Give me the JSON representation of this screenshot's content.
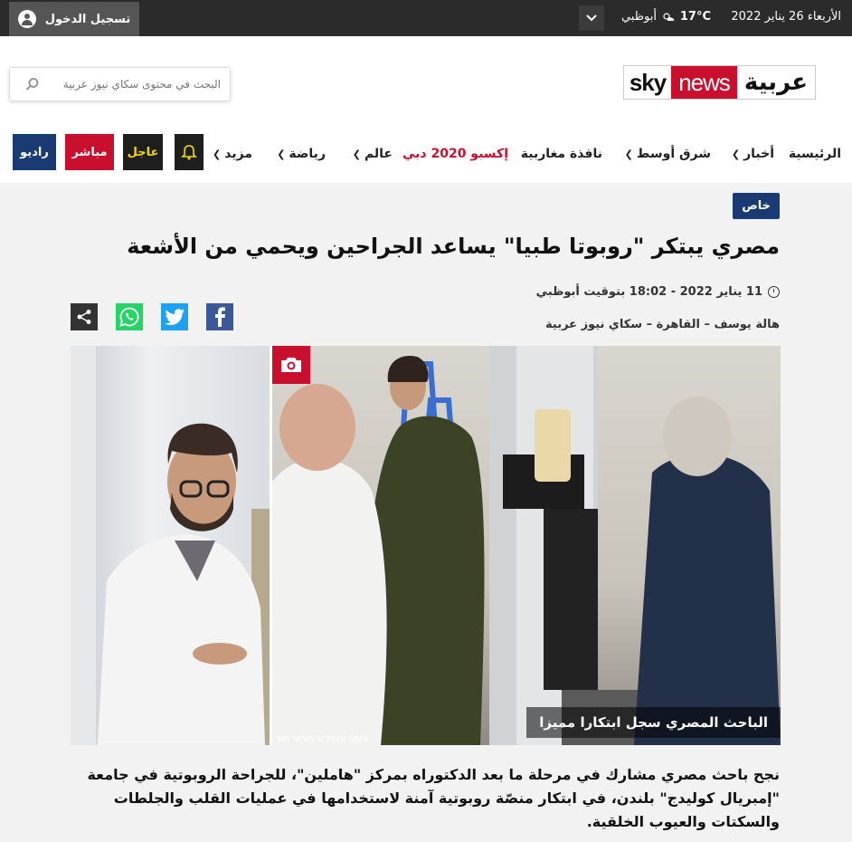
{
  "topbar": {
    "login_label": "تسجيل الدخول",
    "date": "الأربعاء 26 يناير 2022",
    "temperature": "17°C",
    "city": "أبوظبي"
  },
  "header": {
    "search_placeholder": "البحث في محتوى سكاي نيوز عربية",
    "logo": {
      "sky": "sky",
      "news": "news",
      "arabia": "عربية"
    }
  },
  "nav": {
    "items": [
      "الرئيسية",
      "أخبار",
      "شرق أوسط",
      "نافذة مغاربية",
      "إكسبو 2020 دبي",
      "عالم",
      "رياضة",
      "مزيد"
    ],
    "urgent": "عاجل",
    "live": "مباشر",
    "radio": "راديو"
  },
  "article": {
    "tag": "خاص",
    "title": "مصري يبتكر \"روبوتا طبيا\" يساعد الجراحين ويحمي من الأشعة",
    "date": "11 يناير 2022 - 18:02 بتوقيت أبوظبي",
    "byline": "هالة يوسف – القاهرة – سكاي نيوز عربية",
    "image_caption": "الباحث المصري سجل ابتكارا مميزا",
    "image_credit": "SKY NEWS SCREEN GRAB",
    "body": "نجح باحث مصري مشارك في مرحلة ما بعد الدكتوراه بمركز \"هاملين\"، للجراحة الروبوتية في جامعة \"إمبريال كوليدج\" بلندن، في ابتكار منصّة روبوتية آمنة لاستخدامها في عمليات القلب والجلطات والسكتات والعيوب الخلقية."
  },
  "colors": {
    "brand_red": "#c8102e",
    "navy": "#1a3a73",
    "urgent_yellow": "#f5d800",
    "facebook": "#3b5998",
    "twitter": "#1da1f2",
    "whatsapp": "#25d366"
  },
  "icons": [
    "user-icon",
    "weather-icon",
    "chevron-down-icon",
    "search-icon",
    "bell-icon",
    "clock-icon",
    "facebook-icon",
    "twitter-icon",
    "whatsapp-icon",
    "share-icon",
    "camera-icon"
  ]
}
